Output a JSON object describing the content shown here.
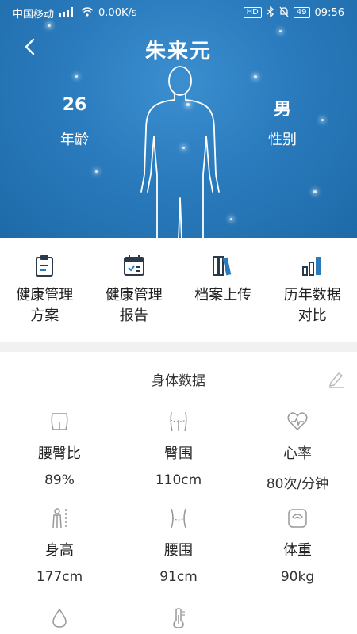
{
  "status_bar": {
    "carrier": "中国移动",
    "network": "⁴ᴳ",
    "speed": "0.00K/s",
    "hd": "HD",
    "battery": "49",
    "time": "09:56"
  },
  "header": {
    "title": "朱来元",
    "age_value": "26",
    "age_label": "年龄",
    "gender_value": "男",
    "gender_label": "性别"
  },
  "menu": [
    {
      "label": "健康管理\n方案",
      "icon": "clipboard-icon"
    },
    {
      "label": "健康管理\n报告",
      "icon": "calendar-check-icon"
    },
    {
      "label": "档案上传",
      "icon": "books-icon"
    },
    {
      "label": "历年数据\n对比",
      "icon": "bar-chart-icon"
    }
  ],
  "body_data": {
    "title": "身体数据",
    "items": [
      {
        "label": "腰臀比",
        "value": "89%",
        "icon": "waist-hip-icon"
      },
      {
        "label": "臀围",
        "value": "110cm",
        "icon": "hip-icon"
      },
      {
        "label": "心率",
        "value": "80次/分钟",
        "icon": "heart-rate-icon"
      },
      {
        "label": "身高",
        "value": "177cm",
        "icon": "height-icon"
      },
      {
        "label": "腰围",
        "value": "91cm",
        "icon": "waist-icon"
      },
      {
        "label": "体重",
        "value": "90kg",
        "icon": "scale-icon"
      },
      {
        "label": "",
        "value": "",
        "icon": "water-drop-icon"
      },
      {
        "label": "",
        "value": "",
        "icon": "thermometer-icon"
      }
    ]
  },
  "colors": {
    "hero": "#2a7bbd",
    "menu_icon": "#2b3a4a",
    "menu_accent": "#2a7bbd",
    "data_icon": "#999999"
  }
}
